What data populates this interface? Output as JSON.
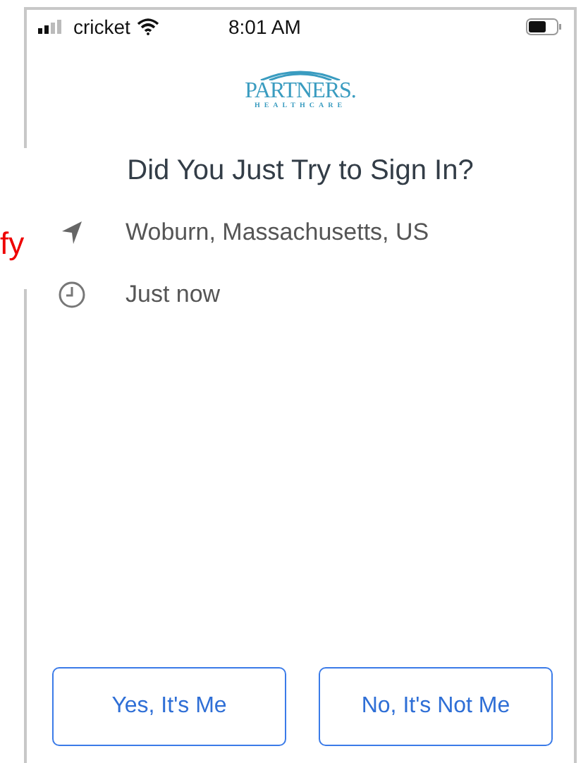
{
  "status_bar": {
    "carrier": "cricket",
    "time": "8:01 AM"
  },
  "logo": {
    "name": "PARTNERS.",
    "subtitle": "HEALTHCARE"
  },
  "title": "Did You Just Try to Sign In?",
  "details": [
    {
      "kind": "location",
      "text": "Woburn, Massachusetts, US"
    },
    {
      "kind": "time",
      "text": "Just now"
    }
  ],
  "buttons": [
    {
      "label": "Yes, It's Me"
    },
    {
      "label": "No, It's Not Me"
    }
  ],
  "margin_note": "fy"
}
